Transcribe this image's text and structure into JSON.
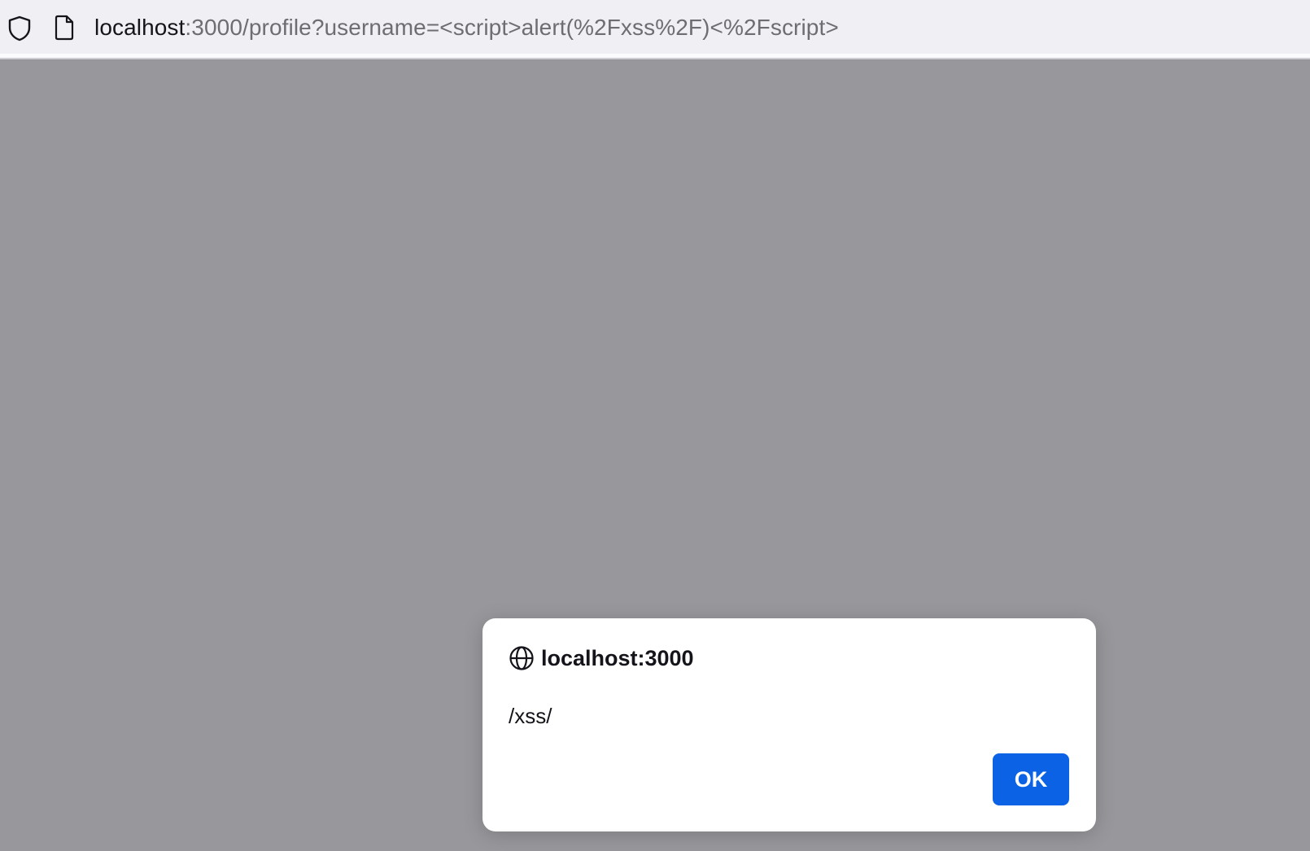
{
  "address_bar": {
    "url_host": "localhost",
    "url_rest": ":3000/profile?username=<script>alert(%2Fxss%2F)<%2Fscript>",
    "shield_icon": "tracking-protection-shield-icon",
    "page_icon": "page-icon"
  },
  "alert_dialog": {
    "icon": "globe-icon",
    "title": "localhost:3000",
    "message": "/xss/",
    "ok_label": "OK"
  },
  "colors": {
    "overlay_background": "#98979b",
    "toolbar_background": "#f0f0f4",
    "button_accent": "#0b62e4"
  }
}
